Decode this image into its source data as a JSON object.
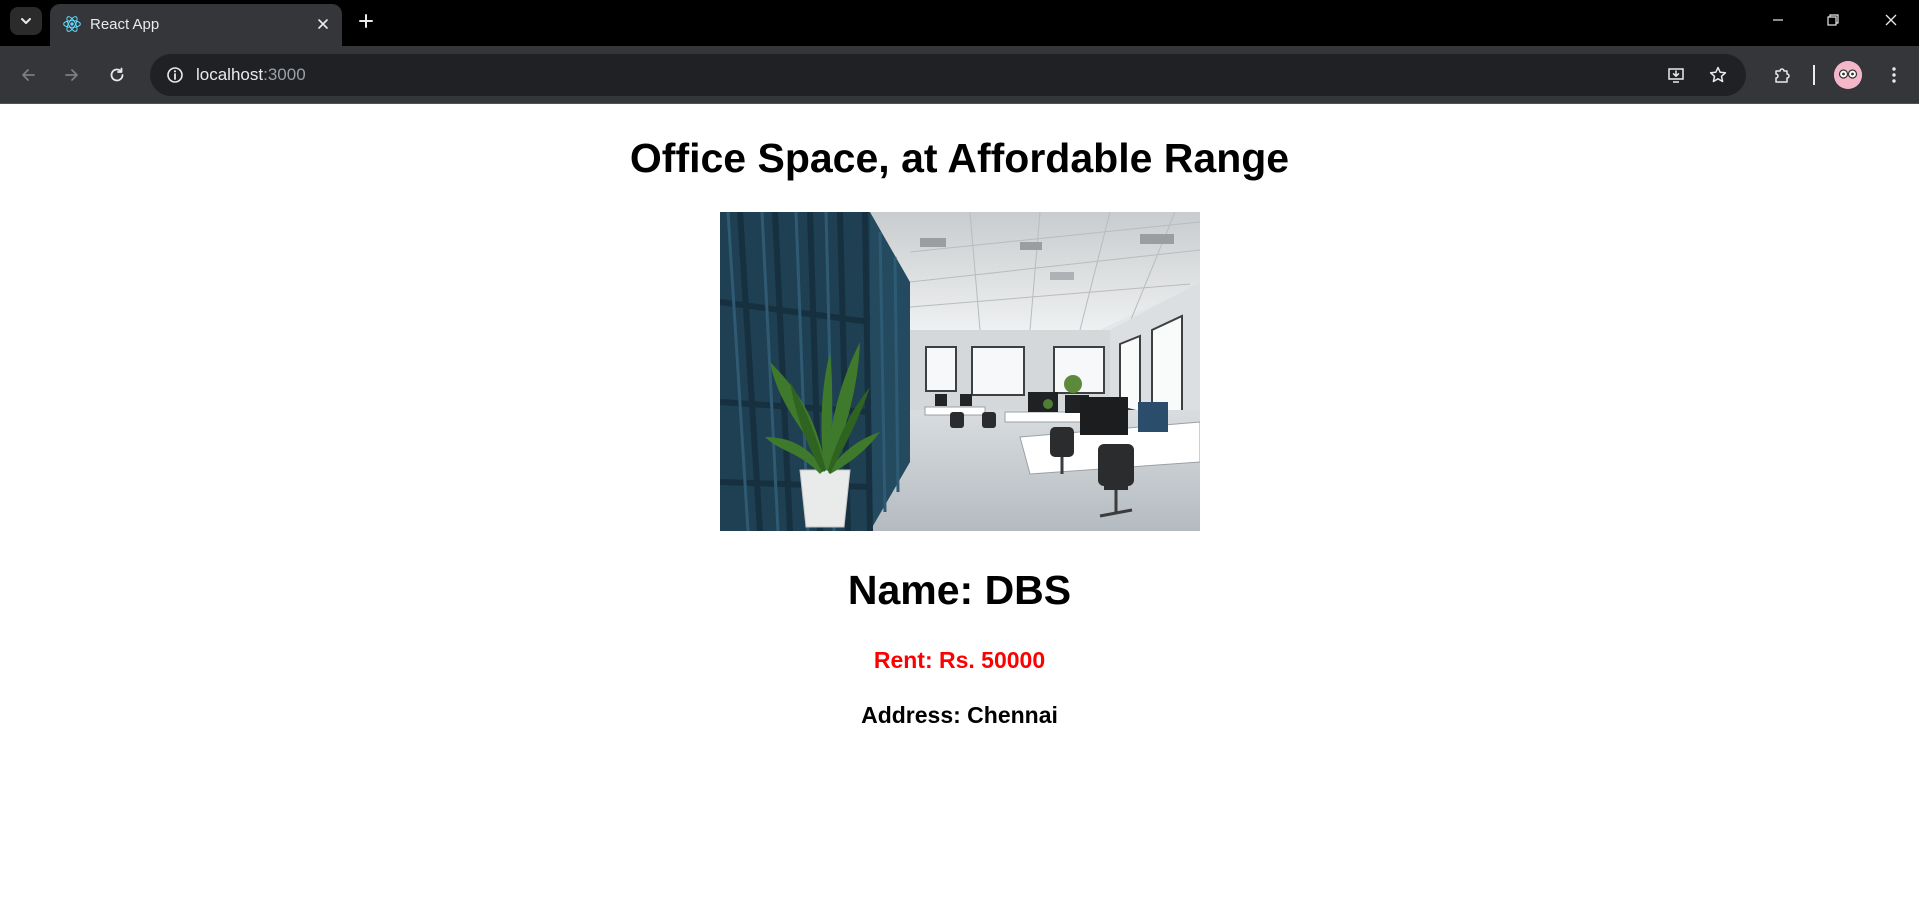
{
  "browser": {
    "tab_title": "React App",
    "url_host": "localhost",
    "url_port": ":3000",
    "icons": {
      "tab_search": "chevron-down-icon",
      "favicon": "react-logo-icon",
      "tab_close": "close-icon",
      "new_tab": "plus-icon",
      "minimize": "minimize-icon",
      "restore": "restore-icon",
      "close_window": "close-icon",
      "back": "arrow-left-icon",
      "forward": "arrow-right-icon",
      "reload": "reload-icon",
      "site_info": "info-icon",
      "install": "install-app-icon",
      "bookmark": "star-icon",
      "extensions": "puzzle-icon",
      "profile": "avatar",
      "menu": "kebab-menu-icon"
    }
  },
  "page": {
    "title": "Office Space, at Affordable Range",
    "image_alt": "Office interior",
    "name": "Name: DBS",
    "rent": "Rent: Rs. 50000",
    "address": "Address: Chennai"
  },
  "colors": {
    "rent_text": "#ff0000",
    "heading_text": "#000000",
    "chrome_dark": "#35363a",
    "tabbar": "#000000"
  }
}
